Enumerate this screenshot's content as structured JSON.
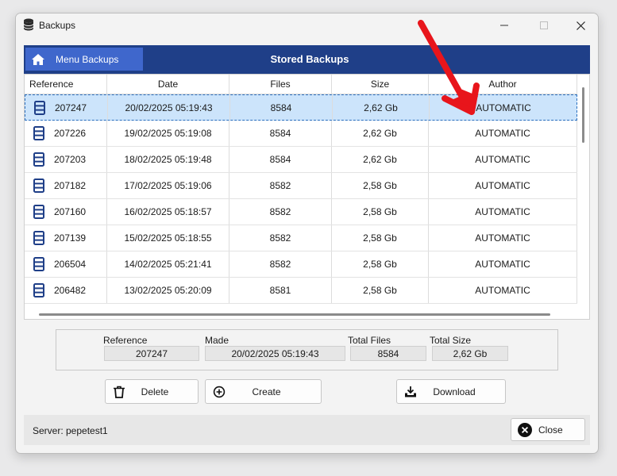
{
  "window": {
    "title": "Backups"
  },
  "header": {
    "menu_label": "Menu Backups",
    "title": "Stored Backups"
  },
  "table": {
    "columns": [
      "Reference",
      "Date",
      "Files",
      "Size",
      "Author"
    ],
    "rows": [
      {
        "reference": "207247",
        "date": "20/02/2025 05:19:43",
        "files": "8584",
        "size": "2,62 Gb",
        "author": "AUTOMATIC",
        "selected": true
      },
      {
        "reference": "207226",
        "date": "19/02/2025 05:19:08",
        "files": "8584",
        "size": "2,62 Gb",
        "author": "AUTOMATIC"
      },
      {
        "reference": "207203",
        "date": "18/02/2025 05:19:48",
        "files": "8584",
        "size": "2,62 Gb",
        "author": "AUTOMATIC"
      },
      {
        "reference": "207182",
        "date": "17/02/2025 05:19:06",
        "files": "8582",
        "size": "2,58 Gb",
        "author": "AUTOMATIC"
      },
      {
        "reference": "207160",
        "date": "16/02/2025 05:18:57",
        "files": "8582",
        "size": "2,58 Gb",
        "author": "AUTOMATIC"
      },
      {
        "reference": "207139",
        "date": "15/02/2025 05:18:55",
        "files": "8582",
        "size": "2,58 Gb",
        "author": "AUTOMATIC"
      },
      {
        "reference": "206504",
        "date": "14/02/2025 05:21:41",
        "files": "8582",
        "size": "2,58 Gb",
        "author": "AUTOMATIC"
      },
      {
        "reference": "206482",
        "date": "13/02/2025 05:20:09",
        "files": "8581",
        "size": "2,58 Gb",
        "author": "AUTOMATIC"
      }
    ]
  },
  "details": {
    "reference_label": "Reference",
    "reference_value": "207247",
    "made_label": "Made",
    "made_value": "20/02/2025 05:19:43",
    "files_label": "Total Files",
    "files_value": "8584",
    "size_label": "Total Size",
    "size_value": "2,62 Gb"
  },
  "buttons": {
    "delete": "Delete",
    "create": "Create",
    "download": "Download",
    "close": "Close"
  },
  "footer": {
    "server": "Server: pepetest1"
  },
  "icons": {
    "app": "database-icon",
    "home": "home-icon",
    "row": "backup-record-icon",
    "delete": "trash-icon",
    "create": "add-circle-icon",
    "download": "download-icon",
    "close": "close-circle-icon"
  },
  "colors": {
    "header": "#1f3f88",
    "menu_button": "#3f67cc",
    "selection": "#cce4fb",
    "row_icon": "#1f3f88",
    "annotation_arrow": "#e8151b"
  }
}
